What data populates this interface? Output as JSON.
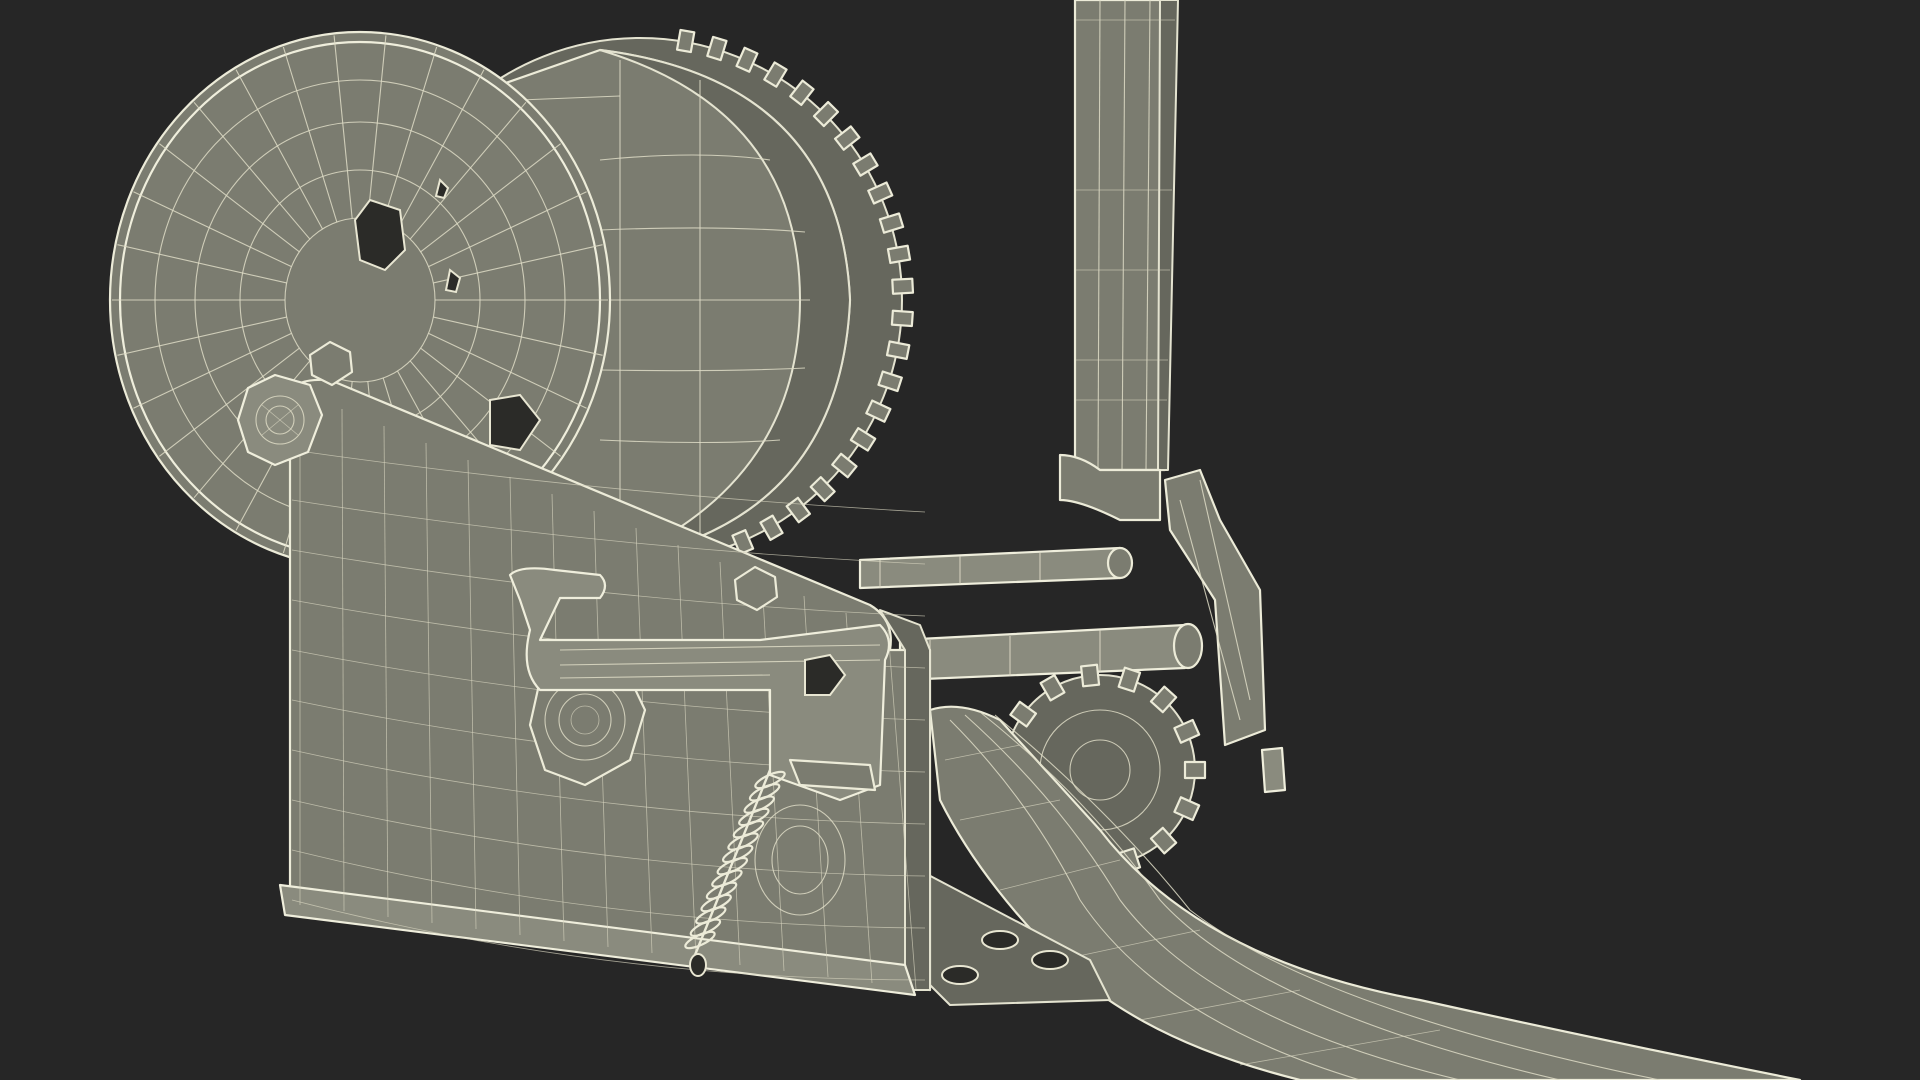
{
  "scene": {
    "background_color": "#262626",
    "mesh_fill_color": "#7b7c70",
    "wire_color": "#ecebd8",
    "render_style": "wireframe-over-shaded"
  },
  "parts": [
    {
      "name": "cable-drum",
      "kind": "spool"
    },
    {
      "name": "drum-flange",
      "kind": "disc"
    },
    {
      "name": "drive-gear",
      "kind": "spur-gear"
    },
    {
      "name": "side-frame-plate",
      "kind": "plate"
    },
    {
      "name": "crank-handle",
      "kind": "arm"
    },
    {
      "name": "pawl-lever",
      "kind": "lever"
    },
    {
      "name": "tension-spring",
      "kind": "coil-spring"
    },
    {
      "name": "cross-rods",
      "kind": "shaft"
    },
    {
      "name": "pinion-gear",
      "kind": "spur-gear"
    },
    {
      "name": "winch-strap",
      "kind": "belt"
    }
  ]
}
